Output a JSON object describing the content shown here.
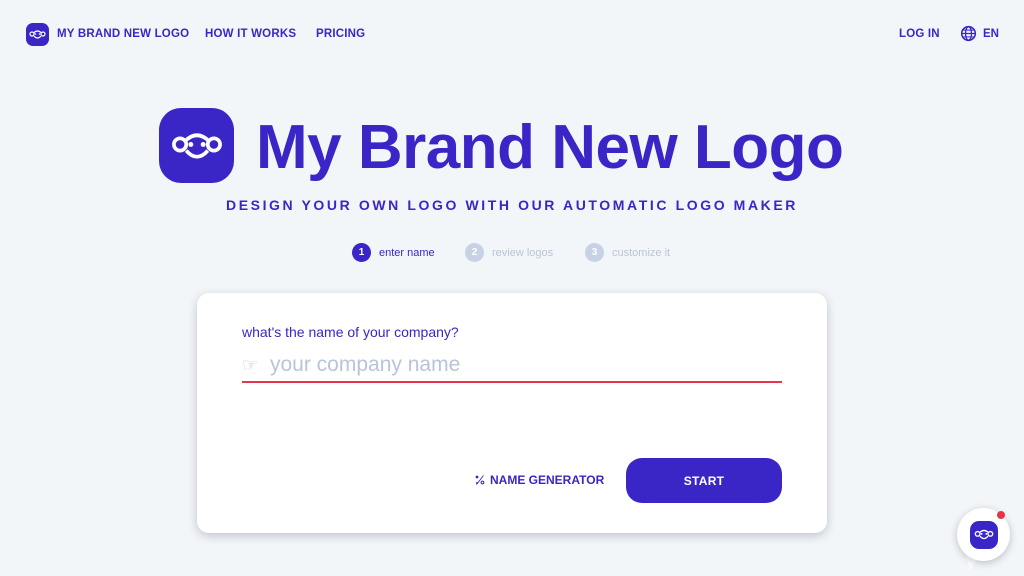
{
  "colors": {
    "background": "#f3f6f8",
    "brand": "#3a26c6",
    "muted": "#b8c4da",
    "accent_red": "#e8344a",
    "card": "#ffffff"
  },
  "nav": {
    "logo_icon": "monkey-face-icon",
    "brand_label": "MY BRAND NEW LOGO",
    "how_it_works": "HOW IT WORKS",
    "pricing": "PRICING",
    "login": "LOG IN",
    "lang_icon": "globe-icon",
    "language": "EN"
  },
  "hero": {
    "logo_icon": "monkey-face-icon",
    "title": "My Brand New Logo",
    "tagline": "DESIGN YOUR OWN LOGO WITH OUR AUTOMATIC LOGO MAKER"
  },
  "steps": [
    {
      "number": "1",
      "label": "enter name",
      "active": true
    },
    {
      "number": "2",
      "label": "review logos",
      "active": false
    },
    {
      "number": "3",
      "label": "customize it",
      "active": false
    }
  ],
  "form": {
    "question": "what's the name of your company?",
    "input_icon": "pointing-hand-icon",
    "input_placeholder": "your company name",
    "input_value": "",
    "name_generator_icon": "sparkle-icon",
    "name_generator": "NAME GENERATOR",
    "start": "START"
  },
  "chat": {
    "icon": "monkey-face-icon",
    "has_notification": true
  }
}
